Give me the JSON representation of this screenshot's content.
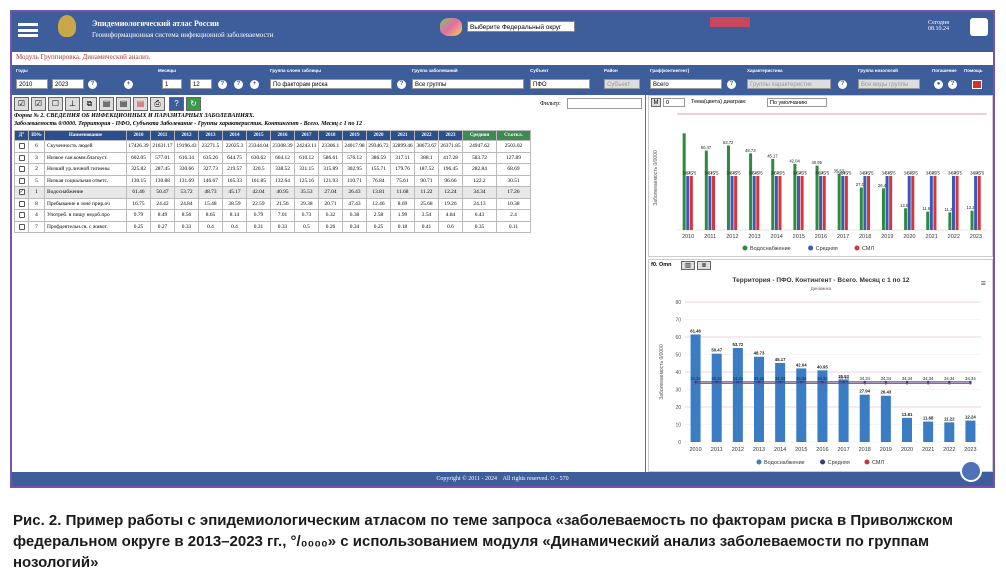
{
  "header": {
    "atlas_title": "Эпидемиологический атлас России",
    "atlas_subtitle": "Геоинформационная система инфекционной заболеваемости",
    "federal_select": "Выберите Федеральный округ",
    "today_label": "Сегодня",
    "today_date": "08.10.24"
  },
  "module_title": "Модуль Группировка. Динамический анализ.",
  "controls": {
    "year_label": "Годы",
    "year_from": "2010",
    "year_to": "2023",
    "month_label": "Месяцы",
    "month_from": "1",
    "month_to": "12",
    "table_label": "Группа слоев таблицы",
    "table_value": "По факторам риска",
    "disease_label": "Группа заболеваний",
    "disease_value": "Все группы",
    "subject_label": "Субъект",
    "subject_value": "ПФО",
    "district_label": "Район",
    "district_value": "Субъект",
    "contingent_label": "Граф(контингент)",
    "contingent_value": "Всего",
    "char_label": "Характеристика",
    "char_value": "Группы характеристик",
    "nosology_label": "Группа нозологий",
    "nosology_value": "Все виды группы",
    "output_label": "Погашение",
    "help_label": "Помощь"
  },
  "table_panel": {
    "filter_label": "Фильтр:",
    "title1": "Форма № 2. СВЕДЕНИЯ ОБ ИНФЕКЦИОННЫХ И ПАРАЗИТАРНЫХ ЗАБОЛЕВАНИЯХ.",
    "title2": "Заболеваемость 0/0000. Территория - ПФО, Субъекта Заболевание - Группы характеристик. Контингент - Всего. Месяц с 1 по 12",
    "headers": [
      "Д°",
      "ID№",
      "Наименование",
      "2010",
      "2011",
      "2012",
      "2013",
      "2014",
      "2015",
      "2016",
      "2017",
      "2018",
      "2019",
      "2020",
      "2021",
      "2022",
      "2023",
      "Средняя",
      "Ст.откл."
    ],
    "rows": [
      {
        "id": "6",
        "name": "Скученность людей",
        "checked": false,
        "values": [
          "17426.39",
          "21631.17",
          "19196.43",
          "23271.5",
          "22025.3",
          "23344.04",
          "23308.39",
          "24243.11",
          "23306.1",
          "24017.98",
          "29346.72",
          "32899.46",
          "38673.67",
          "26371.85",
          "24947.62",
          "2503.02"
        ]
      },
      {
        "id": "3",
        "name": "Низкое сан.комм.благоуст.",
        "checked": false,
        "values": [
          "602.05",
          "577.01",
          "616.34",
          "635.26",
          "644.75",
          "630.62",
          "664.12",
          "610.12",
          "586.61",
          "576.12",
          "386.59",
          "317.11",
          "388.1",
          "417.28",
          "583.72",
          "127.89"
        ]
      },
      {
        "id": "2",
        "name": "Низкий ур.личной гигиены",
        "checked": false,
        "values": [
          "325.82",
          "287.45",
          "330.66",
          "327.73",
          "219.57",
          "320.5",
          "338.52",
          "331.15",
          "315.89",
          "302.95",
          "155.71",
          "179.76",
          "187.52",
          "196.45",
          "282.84",
          "68.69"
        ]
      },
      {
        "id": "5",
        "name": "Низкая социальная ответс.",
        "checked": false,
        "values": [
          "130.15",
          "130.88",
          "131.69",
          "146.67",
          "165.33",
          "161.85",
          "132.64",
          "125.16",
          "121.93",
          "110.71",
          "76.84",
          "75.61",
          "90.71",
          "96.66",
          "122.2",
          "30.51"
        ]
      },
      {
        "id": "1",
        "name": "Водоснабжение",
        "checked": true,
        "values": [
          "61.46",
          "50.47",
          "53.72",
          "48.73",
          "45.17",
          "42.04",
          "40.95",
          "35.53",
          "27.04",
          "26.43",
          "13.81",
          "11.68",
          "11.22",
          "12.24",
          "34.34",
          "17.26"
        ]
      },
      {
        "id": "8",
        "name": "Пребывание в зоне прир.оч",
        "checked": false,
        "values": [
          "16.75",
          "24.42",
          "24.84",
          "15.48",
          "38.59",
          "22.59",
          "21.56",
          "29.38",
          "20.71",
          "47.43",
          "12.46",
          "8.69",
          "25.68",
          "19.26",
          "24.13",
          "10.38"
        ]
      },
      {
        "id": "4",
        "name": "Употреб. в пищу недоб.про",
        "checked": false,
        "values": [
          "9.79",
          "8.49",
          "8.56",
          "8.65",
          "8.14",
          "6.79",
          "7.01",
          "6.73",
          "6.32",
          "6.38",
          "2.58",
          "1.99",
          "3.54",
          "4.84",
          "6.43",
          "2.4"
        ]
      },
      {
        "id": "7",
        "name": "Профдеятельн.св. с живот.",
        "checked": false,
        "values": [
          "0.25",
          "0.27",
          "0.33",
          "0.4",
          "0.4",
          "0.31",
          "0.33",
          "0.5",
          "0.26",
          "0.34",
          "0.25",
          "0.18",
          "0.41",
          "0.6",
          "0.35",
          "0.11"
        ]
      }
    ]
  },
  "chart_controls": {
    "m_label": "М",
    "m_value": "0",
    "theme_label": "Тема(цвета) диаграм:",
    "theme_value": "По умолчанию"
  },
  "chart_data": [
    {
      "type": "bar",
      "title": "",
      "ylabel": "Заболеваемость 0/0000",
      "categories": [
        "2010",
        "2011",
        "2012",
        "2013",
        "2014",
        "2015",
        "2016",
        "2017",
        "2018",
        "2019",
        "2020",
        "2021",
        "2022",
        "2023"
      ],
      "ylim": [
        0,
        75
      ],
      "series": [
        {
          "name": "Водоснабжение",
          "color": "#2e8b3e",
          "values": [
            61.46,
            50.47,
            53.72,
            48.73,
            45.17,
            42.04,
            40.95,
            35.53,
            27.04,
            26.43,
            13.81,
            11.68,
            11.22,
            12.24
          ],
          "labels": [
            "",
            "50.47",
            "53.72",
            "48.73",
            "45.17",
            "42.04",
            "40.95",
            "35.53",
            "27.04",
            "26.43",
            "13.81",
            "11.68",
            "11.22",
            "12.24"
          ]
        },
        {
          "name": "Средняя",
          "color": "#3c59b5",
          "values": [
            34.34,
            34.34,
            34.34,
            34.34,
            34.34,
            34.34,
            34.34,
            34.34,
            34.34,
            34.34,
            34.34,
            34.34,
            34.34,
            34.34
          ],
          "labels": [
            "34.75",
            "34.75",
            "34.75",
            "34.75",
            "34.75",
            "34.75",
            "34.75",
            "34.75",
            "34.75",
            "34.75",
            "34.75",
            "34.75",
            "34.75",
            "34.75"
          ]
        },
        {
          "name": "СМЛ",
          "color": "#d9343a",
          "values": [
            34.34,
            34.34,
            34.34,
            34.34,
            34.34,
            34.34,
            34.34,
            34.34,
            34.34,
            34.34,
            34.34,
            34.34,
            34.34,
            34.34
          ],
          "labels": [
            "34.75",
            "34.75",
            "34.75",
            "34.75",
            "34.75",
            "34.75",
            "34.75",
            "34.75",
            "34.75",
            "34.75",
            "34.75",
            "34.75",
            "34.75",
            "34.75"
          ]
        }
      ],
      "legend": "bottom"
    },
    {
      "type": "bar",
      "title": "Территория - ПФО. Контингент - Всего. Месяц с 1 по 12",
      "subtitle": "Динамика",
      "ylabel": "Заболеваемость 0/0000",
      "categories": [
        "2010",
        "2011",
        "2012",
        "2013",
        "2014",
        "2015",
        "2016",
        "2017",
        "2018",
        "2019",
        "2020",
        "2021",
        "2022",
        "2023"
      ],
      "ylim": [
        0,
        80
      ],
      "yticks": [
        0,
        10,
        20,
        30,
        40,
        50,
        60,
        70,
        80
      ],
      "series": [
        {
          "name": "Водоснабжение",
          "color": "#3b7dc4",
          "values": [
            61.46,
            50.47,
            53.72,
            48.73,
            45.17,
            42.04,
            40.95,
            35.53,
            27.04,
            26.43,
            13.81,
            11.68,
            11.22,
            12.24
          ],
          "labels": [
            "61.46",
            "50.47",
            "53.72",
            "48.73",
            "45.17",
            "42.04",
            "40.95",
            "35.53",
            "27.94",
            "26.43",
            "13.81",
            "11.68",
            "11.22",
            "12.24"
          ]
        },
        {
          "name": "Средняя",
          "color": "#2f3d8a",
          "values": [
            34.34,
            34.34,
            34.34,
            34.34,
            34.34,
            34.34,
            34.34,
            34.34,
            34.34,
            34.34,
            34.34,
            34.34,
            34.34,
            34.34
          ],
          "labels": [
            "34.34",
            "34.34",
            "34.34",
            "34.34",
            "34.34",
            "34.34",
            "34.34",
            "34.34",
            "34.34",
            "34.34",
            "34.34",
            "34.34",
            "34.34",
            "34.34"
          ]
        },
        {
          "name": "СМЛ",
          "color": "#c8353a",
          "values": [
            34.34,
            34.34,
            34.34,
            34.34,
            34.34,
            34.34,
            34.34,
            34.34,
            34.34,
            34.34,
            34.34,
            34.34,
            34.34,
            34.34
          ]
        }
      ],
      "legend": "bottom"
    }
  ],
  "second_chart_tab": "f0. Оmn",
  "footer": {
    "text": "Copyright © 2011 - 2024",
    "text2": "All rights reserved. О - 570"
  },
  "caption": "Рис. 2. Пример работы с эпидемиологическим атласом по теме запроса «заболеваемость по факторам риска в Приволжском федеральном округе в 2013–2023 гг., °/₀₀₀₀» с использованием модуля «Динамический анализ заболеваемости по группам нозологий»"
}
